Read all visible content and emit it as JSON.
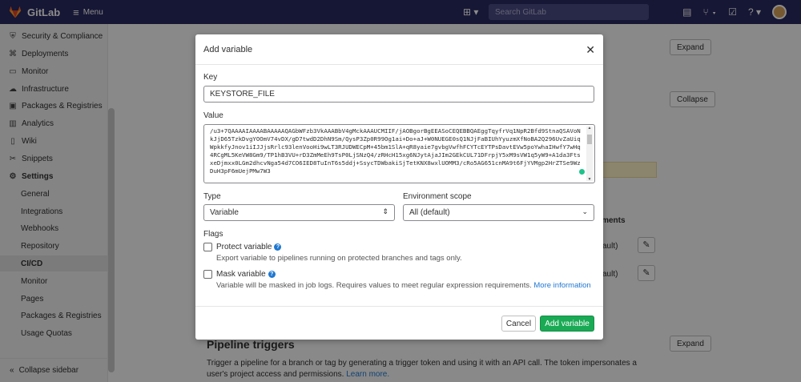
{
  "topbar": {
    "brand": "GitLab",
    "menu_label": "Menu",
    "search_placeholder": "Search GitLab"
  },
  "sidebar": {
    "items": [
      {
        "label": "Security & Compliance",
        "icon": "shield-icon"
      },
      {
        "label": "Deployments",
        "icon": "rocket-icon"
      },
      {
        "label": "Monitor",
        "icon": "monitor-icon"
      },
      {
        "label": "Infrastructure",
        "icon": "cloud-icon"
      },
      {
        "label": "Packages & Registries",
        "icon": "package-icon"
      },
      {
        "label": "Analytics",
        "icon": "chart-icon"
      },
      {
        "label": "Wiki",
        "icon": "book-icon"
      },
      {
        "label": "Snippets",
        "icon": "snippet-icon"
      },
      {
        "label": "Settings",
        "icon": "gear-icon"
      }
    ],
    "sub_items": [
      "General",
      "Integrations",
      "Webhooks",
      "Repository",
      "CI/CD",
      "Monitor",
      "Pages",
      "Packages & Registries",
      "Usage Quotas"
    ],
    "collapse_label": "Collapse sidebar"
  },
  "page": {
    "expand_label": "Expand",
    "collapse_label": "Collapse",
    "envs_heading": "nments",
    "default_fragment": "ault)",
    "pipeline_title": "Pipeline triggers",
    "pipeline_desc": "Trigger a pipeline for a branch or tag by generating a trigger token and using it with an API call. The token impersonates a user's project access and permissions.",
    "learn_more": "Learn more."
  },
  "modal": {
    "title": "Add variable",
    "key_label": "Key",
    "key_value": "KEYSTORE_FILE",
    "value_label": "Value",
    "value_text": "/u3+7QAAAAIAAAABAAAAAQAGbWFzb3VkAAABbV4gMckAAAUCMIIF/jAOBgorBgEEASoCEQEBBQAEggTqyfrVq1NpR2Bfd9StnaQSAVoNkJjD65TzkDvgYOOmV74vDX/gD7twdD2DhN9Sm/QysP3Zp0R99Og1ai+Do+aJ+W0NUEGE0sQ1NJjFaBIUhYyuzmXfNoBA2Q296UvZaUiqWpkkfyJnov1iIJJjsRrlc93lenVooHi9wLT3RJUDWECpM+45bm1SlA+qR8yaie7gvbgVwfhFCYTcEYTPsDavtEVw5poYwhaIHwfY7wHq4RCgML5KeVW8Gm9/TP1hB3VU+rD3ZmMeEh9TsP0LjSNzQ4/zRHcH15xg6NJytAjaJIm2GEkCUL71DFrpjY5xM9sVW1q5yW9+A1da3FtsxeDjmxx0LGm2dhcvNga54d7CO6IED8TuInT6s5ddj+SsycTDWbakiSjTetKNX8wxlUOMM3/cRo5AG651cnMA9t6FjYVMgp2HrZTSe9WzDuH3pF6mUejPMw7W3",
    "type_label": "Type",
    "type_value": "Variable",
    "scope_label": "Environment scope",
    "scope_value": "All (default)",
    "flags_label": "Flags",
    "protect_label": "Protect variable",
    "protect_help": "Export variable to pipelines running on protected branches and tags only.",
    "mask_label": "Mask variable",
    "mask_help": "Variable will be masked in job logs. Requires values to meet regular expression requirements.",
    "more_info": "More information",
    "cancel_label": "Cancel",
    "add_label": "Add variable",
    "protect_checked": false,
    "mask_checked": false
  },
  "colors": {
    "navbar": "#292961",
    "primary_button": "#1aaa55",
    "link": "#1f78d1"
  }
}
